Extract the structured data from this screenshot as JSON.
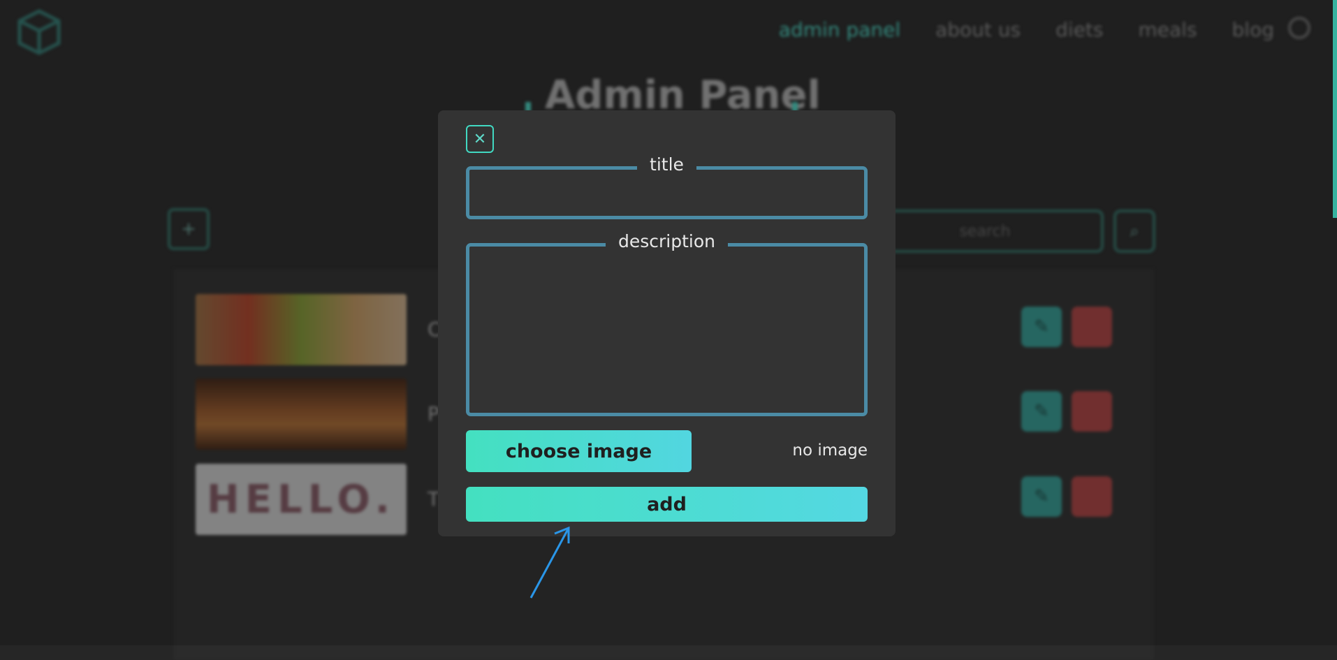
{
  "nav": {
    "items": [
      "admin panel",
      "about us",
      "diets",
      "meals",
      "blog"
    ],
    "active_index": 0
  },
  "page": {
    "title": "Admin Panel"
  },
  "toolbar": {
    "add_icon": "plus-icon",
    "search_placeholder": "search",
    "search_icon": "search-icon"
  },
  "list": {
    "rows": [
      {
        "thumb": "food",
        "initial": "C"
      },
      {
        "thumb": "pizza",
        "initial": "P"
      },
      {
        "thumb": "hello",
        "thumb_text": "HELLO.",
        "initial": "T"
      }
    ]
  },
  "modal": {
    "close_icon": "close-icon",
    "title_label": "title",
    "title_value": "",
    "description_label": "description",
    "description_value": "",
    "choose_image_label": "choose image",
    "image_status": "no image",
    "add_label": "add"
  },
  "colors": {
    "accent": "#41d9c2",
    "field_border": "#4b8ba5",
    "modal_bg": "#333333",
    "page_bg": "#262626",
    "edit": "#2f7d77",
    "delete": "#8a3a3a"
  }
}
